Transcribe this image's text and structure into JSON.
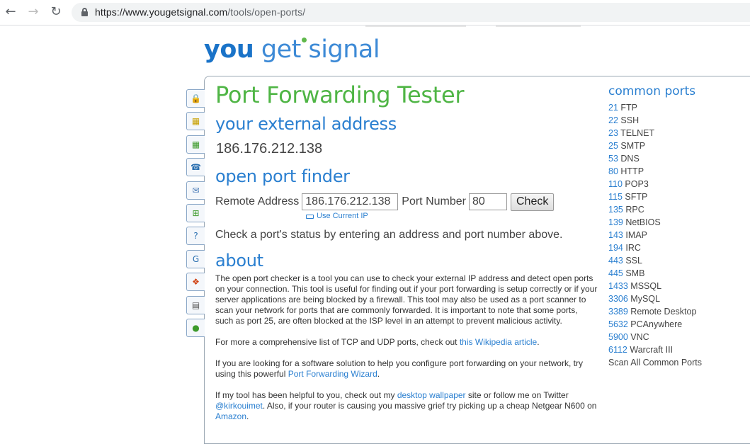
{
  "browser": {
    "url_host": "https://www.yougetsignal.com",
    "url_path": "/tools/open-ports/"
  },
  "logo": {
    "you": "you",
    "get": "get signal"
  },
  "page": {
    "title": "Port Forwarding Tester",
    "external_heading": "your external address",
    "external_ip": "186.176.212.138",
    "finder_heading": "open port finder",
    "remote_label": "Remote Address",
    "remote_value": "186.176.212.138",
    "port_label": "Port Number",
    "port_value": "80",
    "check_label": "Check",
    "use_current": "Use Current IP",
    "status_msg": "Check a port's status by entering an address and port number above.",
    "about_heading": "about"
  },
  "about": {
    "p1": "The open port checker is a tool you can use to check your external IP address and detect open ports on your connection. This tool is useful for finding out if your port forwarding is setup correctly or if your server applications are being blocked by a firewall. This tool may also be used as a port scanner to scan your network for ports that are commonly forwarded. It is important to note that some ports, such as port 25, are often blocked at the ISP level in an attempt to prevent malicious activity.",
    "p2_pre": "For more a comprehensive list of TCP and UDP ports, check out ",
    "p2_link": "this Wikipedia article",
    "p2_post": ".",
    "p3_pre": "If you are looking for a software solution to help you configure port forwarding on your network, try using this powerful ",
    "p3_link": "Port Forwarding Wizard",
    "p3_post": ".",
    "p4_pre": "If my tool has been helpful to you, check out my ",
    "p4_link1": "desktop wallpaper",
    "p4_mid1": " site or follow me on Twitter ",
    "p4_link2": "@kirkouimet",
    "p4_mid2": ". Also, if your router is causing you massive grief try picking up a cheap Netgear N600 on ",
    "p4_link3": "Amazon",
    "p4_post": "."
  },
  "common_ports": {
    "title": "common ports",
    "items": [
      {
        "num": "21",
        "name": "FTP"
      },
      {
        "num": "22",
        "name": "SSH"
      },
      {
        "num": "23",
        "name": "TELNET"
      },
      {
        "num": "25",
        "name": "SMTP"
      },
      {
        "num": "53",
        "name": "DNS"
      },
      {
        "num": "80",
        "name": "HTTP"
      },
      {
        "num": "110",
        "name": "POP3"
      },
      {
        "num": "115",
        "name": "SFTP"
      },
      {
        "num": "135",
        "name": "RPC"
      },
      {
        "num": "139",
        "name": "NetBIOS"
      },
      {
        "num": "143",
        "name": "IMAP"
      },
      {
        "num": "194",
        "name": "IRC"
      },
      {
        "num": "443",
        "name": "SSL"
      },
      {
        "num": "445",
        "name": "SMB"
      },
      {
        "num": "1433",
        "name": "MSSQL"
      },
      {
        "num": "3306",
        "name": "MySQL"
      },
      {
        "num": "3389",
        "name": "Remote Desktop"
      },
      {
        "num": "5632",
        "name": "PCAnywhere"
      },
      {
        "num": "5900",
        "name": "VNC"
      },
      {
        "num": "6112",
        "name": "Warcraft III"
      }
    ],
    "scan_all": "Scan All Common Ports"
  },
  "side_icons": [
    {
      "name": "lock-icon",
      "glyph": "🔒",
      "color": "#d9a400"
    },
    {
      "name": "map-icon",
      "glyph": "▦",
      "color": "#c8a000"
    },
    {
      "name": "map-search-icon",
      "glyph": "▦",
      "color": "#3c9a2a"
    },
    {
      "name": "phone-icon",
      "glyph": "☎",
      "color": "#2a6fb0"
    },
    {
      "name": "mail-icon",
      "glyph": "✉",
      "color": "#4a7bb7"
    },
    {
      "name": "network-icon",
      "glyph": "⊞",
      "color": "#3c9a2a"
    },
    {
      "name": "help-icon",
      "glyph": "?",
      "color": "#2a6fb0"
    },
    {
      "name": "google-icon",
      "glyph": "G",
      "color": "#2a6fb0"
    },
    {
      "name": "windows-icon",
      "glyph": "❖",
      "color": "#d04010"
    },
    {
      "name": "document-icon",
      "glyph": "▤",
      "color": "#555555"
    },
    {
      "name": "globe-icon",
      "glyph": "●",
      "color": "#3c9a2a"
    }
  ]
}
